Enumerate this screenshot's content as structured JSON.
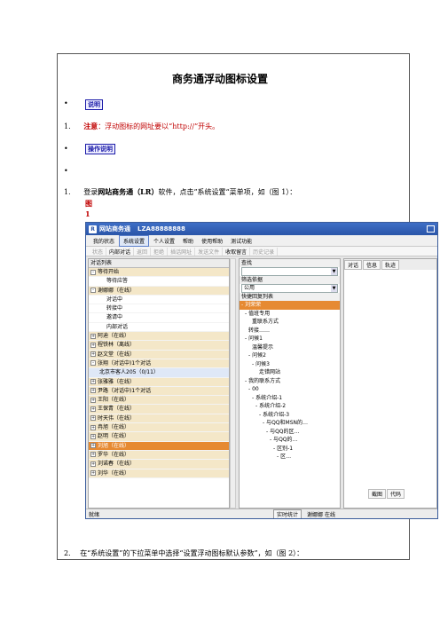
{
  "doc": {
    "title": "商务通浮动图标设置",
    "bullet": "•",
    "tag_note": "说明",
    "tag_ops": "操作说明",
    "item1_num": "1.",
    "item1_label": "注意",
    "item1_text": "：浮动图标的网址要以“http://”开头。",
    "step1_num": "1.",
    "step1_pre": "登录",
    "step1_bold": "网站商务通（LR）",
    "step1_post": "软件，点击”系统设置“菜单项，如（图 1）：",
    "fig_label_a": "图",
    "fig_label_b": "1",
    "step2_num": "2.",
    "step2_text": "在“系统设置”的下拉菜单中选择“设置浮动图标默认参数”，如（图 2）："
  },
  "window": {
    "app_icon": "R",
    "app_name": "网站商务通",
    "account": "LZA88888888",
    "menu": [
      "我的状态",
      "系统设置",
      "个人设置",
      "帮助",
      "使用帮助",
      "测试功能"
    ],
    "toolbar": [
      "状态",
      "内部对话",
      "返回",
      "拒绝",
      "插话网址",
      "发送文件",
      "收取留言",
      "历史记录"
    ],
    "left_header": "对话列表",
    "left_rows": [
      {
        "text": "等待开始",
        "type": "grp",
        "exp": "-"
      },
      {
        "text": "等待应答",
        "type": "ind2",
        "exp": ""
      },
      {
        "text": "谢娜娜（在线）",
        "type": "grp",
        "exp": "-"
      },
      {
        "text": "对话中",
        "type": "ind2",
        "exp": ""
      },
      {
        "text": "转接中",
        "type": "ind2",
        "exp": ""
      },
      {
        "text": "邀请中",
        "type": "ind2",
        "exp": ""
      },
      {
        "text": "内部对话",
        "type": "ind2",
        "exp": ""
      },
      {
        "text": "阿迪（在线）",
        "type": "grp",
        "exp": "+"
      },
      {
        "text": "程铁林（离线）",
        "type": "grp",
        "exp": "+"
      },
      {
        "text": "赵文堂（在线）",
        "type": "grp",
        "exp": "+"
      },
      {
        "text": "张翔（对话中)1个对话",
        "type": "grp",
        "exp": "-"
      },
      {
        "text": "北京市客人205（0/11）",
        "type": "blue",
        "exp": ""
      },
      {
        "text": "张雅雅（在线）",
        "type": "grp",
        "exp": "+"
      },
      {
        "text": "尹路（对话中)1个对话",
        "type": "grp",
        "exp": "+"
      },
      {
        "text": "王阳（在线）",
        "type": "grp",
        "exp": "+"
      },
      {
        "text": "王保青（在线）",
        "type": "grp",
        "exp": "+"
      },
      {
        "text": "时天伟（在线）",
        "type": "grp",
        "exp": "+"
      },
      {
        "text": "冉旭（在线）",
        "type": "grp",
        "exp": "+"
      },
      {
        "text": "赵明（在线）",
        "type": "grp",
        "exp": "+"
      },
      {
        "text": "刘旭（在线）",
        "type": "sel",
        "exp": "+"
      },
      {
        "text": "罗华（在线）",
        "type": "grp",
        "exp": "+"
      },
      {
        "text": "刘诺春（在线）",
        "type": "grp",
        "exp": "+"
      },
      {
        "text": "刘华（在线）",
        "type": "grp",
        "exp": "+"
      }
    ],
    "mid_label_search": "查找",
    "mid_label_filter": "筛选依据",
    "mid_filter_value": "公用",
    "mid_label_quick": "快捷回复列表",
    "mid_rows": [
      {
        "text": "- 刘荣荣",
        "indent": 2,
        "sel": true
      },
      {
        "text": "- 值班专用",
        "indent": 6,
        "sel": false
      },
      {
        "text": "重联系方式",
        "indent": 14,
        "sel": false
      },
      {
        "text": "转接……",
        "indent": 10,
        "sel": false
      },
      {
        "text": "- 问候1",
        "indent": 6,
        "sel": false
      },
      {
        "text": "温馨提示",
        "indent": 14,
        "sel": false
      },
      {
        "text": "- 问候2",
        "indent": 10,
        "sel": false
      },
      {
        "text": "- 问候3",
        "indent": 14,
        "sel": false
      },
      {
        "text": "走错网站",
        "indent": 22,
        "sel": false
      },
      {
        "text": "- 我的联系方式",
        "indent": 6,
        "sel": false
      },
      {
        "text": "- 00",
        "indent": 10,
        "sel": false
      },
      {
        "text": "- 系统介绍-1",
        "indent": 14,
        "sel": false
      },
      {
        "text": "- 系统介绍-2",
        "indent": 18,
        "sel": false
      },
      {
        "text": "- 系统介绍-3",
        "indent": 22,
        "sel": false
      },
      {
        "text": "- 与QQ和MSN的…",
        "indent": 26,
        "sel": false
      },
      {
        "text": "- 与QQ的区…",
        "indent": 30,
        "sel": false
      },
      {
        "text": "- 与QQ的…",
        "indent": 34,
        "sel": false
      },
      {
        "text": "- 区别-1",
        "indent": 38,
        "sel": false
      },
      {
        "text": "- 区…",
        "indent": 42,
        "sel": false
      }
    ],
    "right_tabs": [
      "对话",
      "信息",
      "轨迹"
    ],
    "right_bottom_tabs": [
      "截图",
      "代码"
    ],
    "status": [
      "就绪",
      "实时统计",
      "谢娜娜 在线"
    ]
  }
}
